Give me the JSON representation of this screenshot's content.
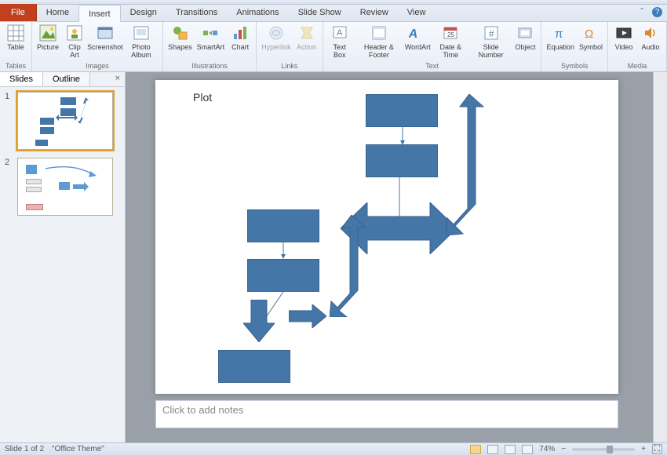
{
  "tabs": {
    "file": "File",
    "items": [
      "Home",
      "Insert",
      "Design",
      "Transitions",
      "Animations",
      "Slide Show",
      "Review",
      "View"
    ],
    "active": "Insert"
  },
  "ribbon": {
    "groups": [
      {
        "label": "Tables",
        "items": [
          {
            "name": "table",
            "label": "Table"
          }
        ]
      },
      {
        "label": "Images",
        "items": [
          {
            "name": "picture",
            "label": "Picture"
          },
          {
            "name": "clipart",
            "label": "Clip\nArt"
          },
          {
            "name": "screenshot",
            "label": "Screenshot"
          },
          {
            "name": "photoalbum",
            "label": "Photo\nAlbum"
          }
        ]
      },
      {
        "label": "Illustrations",
        "items": [
          {
            "name": "shapes",
            "label": "Shapes"
          },
          {
            "name": "smartart",
            "label": "SmartArt"
          },
          {
            "name": "chart",
            "label": "Chart"
          }
        ]
      },
      {
        "label": "Links",
        "items": [
          {
            "name": "hyperlink",
            "label": "Hyperlink",
            "dim": true
          },
          {
            "name": "action",
            "label": "Action",
            "dim": true
          }
        ]
      },
      {
        "label": "Text",
        "items": [
          {
            "name": "textbox",
            "label": "Text\nBox"
          },
          {
            "name": "headerfooter",
            "label": "Header\n& Footer"
          },
          {
            "name": "wordart",
            "label": "WordArt"
          },
          {
            "name": "datetime",
            "label": "Date\n& Time"
          },
          {
            "name": "slidenumber",
            "label": "Slide\nNumber"
          },
          {
            "name": "object",
            "label": "Object"
          }
        ]
      },
      {
        "label": "Symbols",
        "items": [
          {
            "name": "equation",
            "label": "Equation"
          },
          {
            "name": "symbol",
            "label": "Symbol"
          }
        ]
      },
      {
        "label": "Media",
        "items": [
          {
            "name": "video",
            "label": "Video"
          },
          {
            "name": "audio",
            "label": "Audio"
          }
        ]
      }
    ]
  },
  "panel": {
    "tabs": [
      "Slides",
      "Outline"
    ],
    "active": "Slides",
    "close": "×"
  },
  "slides": [
    {
      "num": "1",
      "selected": true
    },
    {
      "num": "2",
      "selected": false
    }
  ],
  "slide": {
    "title": "Plot",
    "shape_fill": "#4576a8",
    "shape_stroke": "#3a628c"
  },
  "notes_placeholder": "Click to add notes",
  "status": {
    "slide": "Slide 1 of 2",
    "theme": "\"Office Theme\"",
    "zoom": "74%"
  }
}
